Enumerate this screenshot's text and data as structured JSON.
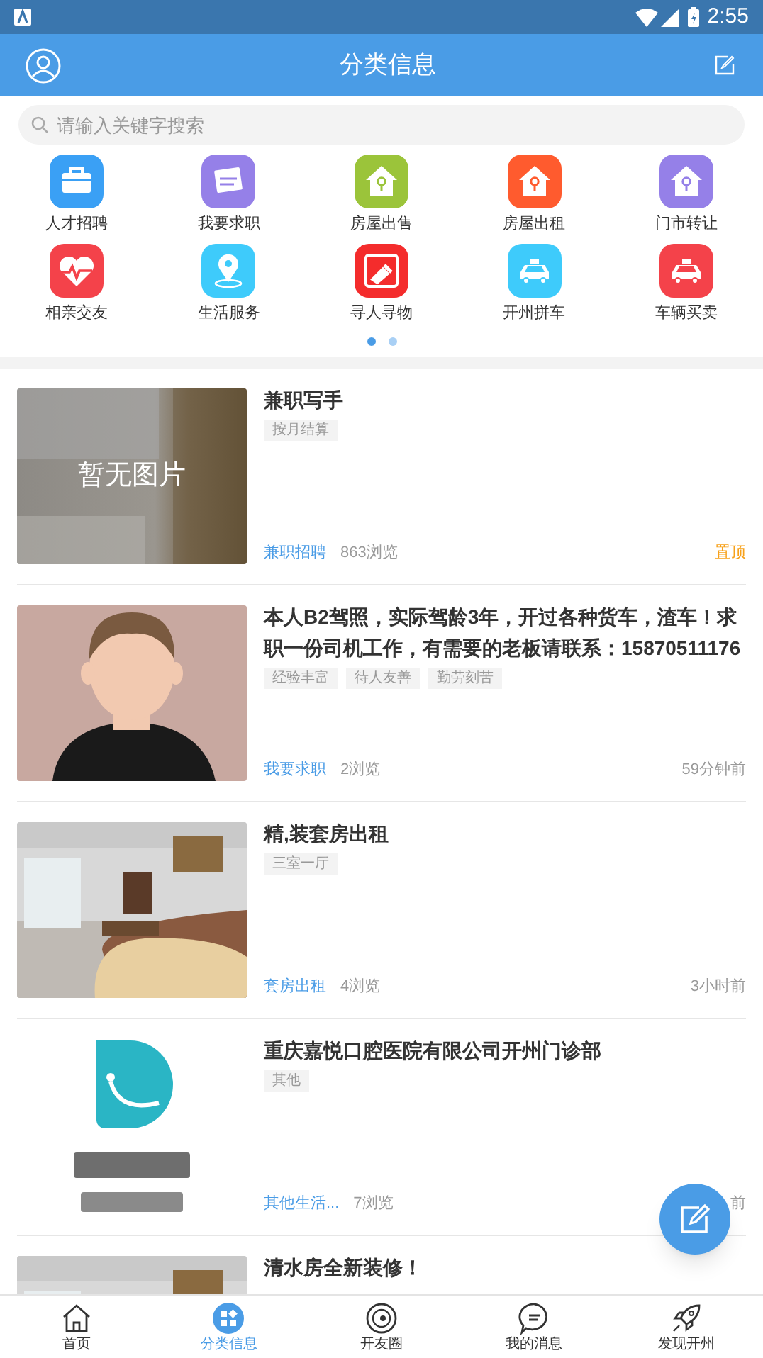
{
  "status_bar": {
    "time": "2:55"
  },
  "header": {
    "title": "分类信息"
  },
  "search": {
    "placeholder": "请输入关键字搜索"
  },
  "categories": [
    {
      "label": "人才招聘",
      "color": "#3aa0f5",
      "kind": "briefcase"
    },
    {
      "label": "我要求职",
      "color": "#9580e8",
      "kind": "job"
    },
    {
      "label": "房屋出售",
      "color": "#9bc43a",
      "kind": "house"
    },
    {
      "label": "房屋出租",
      "color": "#ff5b2e",
      "kind": "house"
    },
    {
      "label": "门市转让",
      "color": "#9580e8",
      "kind": "house"
    },
    {
      "label": "相亲交友",
      "color": "#f4424a",
      "kind": "heart"
    },
    {
      "label": "生活服务",
      "color": "#3ecbfb",
      "kind": "pin"
    },
    {
      "label": "寻人寻物",
      "color": "#f42c2c",
      "kind": "flashlight"
    },
    {
      "label": "开州拼车",
      "color": "#3ecbfb",
      "kind": "car"
    },
    {
      "label": "车辆买卖",
      "color": "#f4424a",
      "kind": "car"
    }
  ],
  "pager": [
    {
      "selected": true
    },
    {
      "selected": false
    }
  ],
  "listings": [
    {
      "kind": "placeholder",
      "image_text": "暂无图片",
      "title": "兼职写手",
      "tags": [
        "按月结算"
      ],
      "category": "兼职招聘",
      "views": "863浏览",
      "badge": "置顶"
    },
    {
      "kind": "figure",
      "title": "本人B2驾照，实际驾龄3年，开过各种货车，渣车！求职一份司机工作，有需要的老板请联系：15870511176",
      "tags": [
        "经验丰富",
        "待人友善",
        "勤劳刻苦"
      ],
      "category": "我要求职",
      "views": "2浏览",
      "time": "59分钟前"
    },
    {
      "kind": "room",
      "title": "精,装套房出租",
      "tags": [
        "三室一厅"
      ],
      "category": "套房出租",
      "views": "4浏览",
      "time": "3小时前"
    },
    {
      "kind": "logo",
      "title": "重庆嘉悦口腔医院有限公司开州门诊部",
      "tags": [
        "其他"
      ],
      "category": "其他生活...",
      "views": "7浏览",
      "time": "前"
    },
    {
      "kind": "room",
      "title": "清水房全新装修！"
    }
  ],
  "nav": [
    {
      "label": "首页",
      "kind": "home",
      "selected": false
    },
    {
      "label": "分类信息",
      "kind": "grid",
      "selected": true
    },
    {
      "label": "开友圈",
      "kind": "orbit",
      "selected": false
    },
    {
      "label": "我的消息",
      "kind": "chat",
      "selected": false
    },
    {
      "label": "发现开州",
      "kind": "rocket",
      "selected": false
    }
  ]
}
